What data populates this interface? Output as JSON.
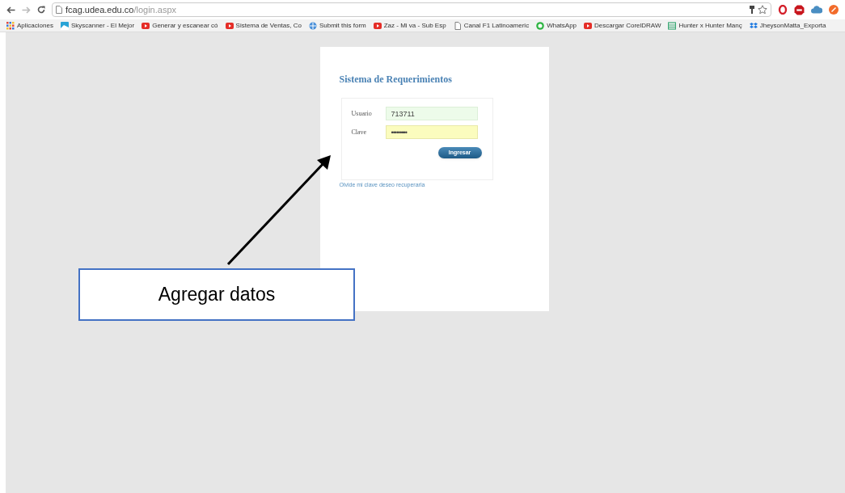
{
  "address_bar": {
    "host": "fcag.udea.edu.co",
    "path": "/login.aspx"
  },
  "bookmarks": [
    {
      "label": "Aplicaciones",
      "kind": "apps"
    },
    {
      "label": "Skyscanner - El Mejor",
      "kind": "image"
    },
    {
      "label": "Generar y escanear có",
      "kind": "video"
    },
    {
      "label": "Sistema de Ventas, Co",
      "kind": "video"
    },
    {
      "label": "Submit this form",
      "kind": "globe"
    },
    {
      "label": "Zaz - Mi va - Sub Esp",
      "kind": "video"
    },
    {
      "label": "Canal F1 Latinoameric",
      "kind": "page"
    },
    {
      "label": "WhatsApp",
      "kind": "chat"
    },
    {
      "label": "Descargar CorelDRAW",
      "kind": "video"
    },
    {
      "label": "Hunter x Hunter Manç",
      "kind": "sheet"
    },
    {
      "label": "JheysonMatta_Exporta",
      "kind": "box"
    }
  ],
  "login": {
    "title": "Sistema de Requerimientos",
    "fields": [
      {
        "label": "Usuario",
        "value": "713711",
        "kind": "text"
      },
      {
        "label": "Clave",
        "value": "•••••••••",
        "kind": "password"
      }
    ],
    "submit": "Ingresar",
    "recover_link": "Olvide mi clave deseo recuperarla"
  },
  "callout": {
    "text": "Agregar datos"
  }
}
